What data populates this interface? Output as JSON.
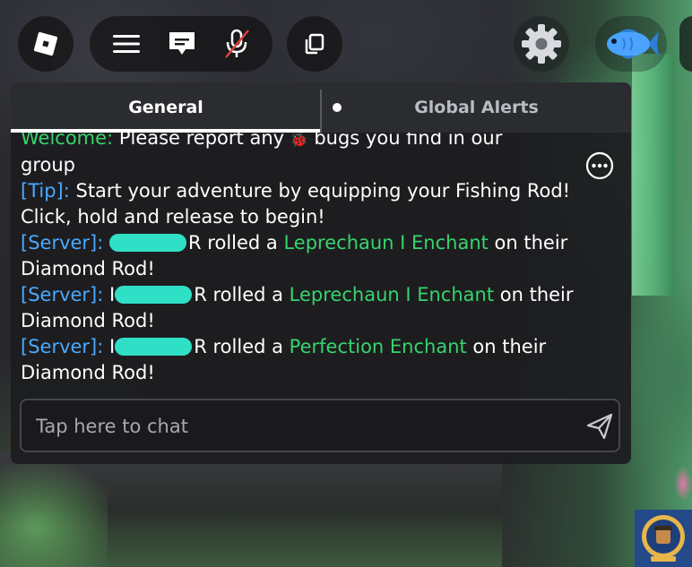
{
  "topbar": {
    "roblox_icon": "roblox-logo-icon",
    "menu_icon": "hamburger-menu-icon",
    "chat_icon": "chat-bubble-icon",
    "mic_icon": "microphone-muted-icon",
    "copy_icon": "copy-icon",
    "settings_icon": "gear-icon",
    "fish_icon": "fish-icon"
  },
  "chat": {
    "tabs": [
      {
        "label": "General",
        "active": true
      },
      {
        "label": "Global Alerts",
        "active": false,
        "unread": true
      }
    ],
    "messages": {
      "welcome_tag": "Welcome:",
      "welcome_text_a": " Please report any ",
      "welcome_text_b": " bugs you find in our",
      "welcome_text_c": "group",
      "tip_tag": "[Tip]:",
      "tip_text": " Start your adventure by equipping your Fishing Rod! Click, hold and release to begin!",
      "server_tag": "[Server]:",
      "rolled_a": "rolled a ",
      "on_their": " on their",
      "diamond_rod": "Diamond Rod!",
      "enchant_1": "Leprechaun I Enchant",
      "enchant_2": "Leprechaun I Enchant",
      "enchant_3": "Perfection Enchant",
      "name_suffix_1": "R",
      "name_prefix_2": "I",
      "name_suffix_2": "R",
      "name_prefix_3": "I",
      "name_suffix_3": "R"
    },
    "input": {
      "placeholder": "Tap here to chat",
      "value": ""
    },
    "more_icon": "more-options-icon",
    "send_icon": "send-icon"
  },
  "colors": {
    "tag_blue": "#4aa9ff",
    "enchant_green": "#37d46c",
    "redaction": "#2fe0c6"
  }
}
